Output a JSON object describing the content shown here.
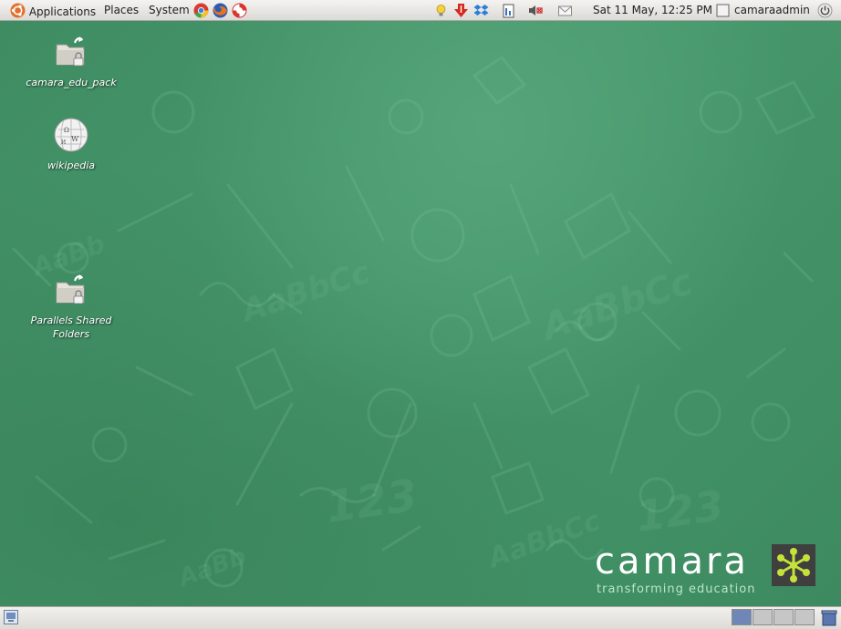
{
  "top_panel": {
    "menus": [
      {
        "label": "Applications",
        "icon": "ubuntu-logo-icon"
      },
      {
        "label": "Places"
      },
      {
        "label": "System"
      }
    ],
    "launchers": [
      "chrome-icon",
      "firefox-icon",
      "help-lifebuoy-icon"
    ],
    "tray": [
      "lightbulb-icon",
      "download-arrow-icon",
      "dropbox-icon",
      "clipboard-icon",
      "volume-muted-icon",
      "mail-icon"
    ],
    "clock": "Sat 11 May, 12:25 PM",
    "user": "camaraadmin",
    "power_icon": "power-icon"
  },
  "desktop": {
    "icons": [
      {
        "label": "camara_edu_pack",
        "icon": "shared-folder-icon"
      },
      {
        "label": "wikipedia",
        "icon": "wikipedia-globe-icon"
      },
      {
        "label": "Parallels Shared Folders",
        "icon": "shared-folder-icon"
      }
    ],
    "brand": {
      "name": "camara",
      "tagline": "transforming education",
      "logo_color": "#c5e23a"
    },
    "colors": {
      "background": "#3f8d63",
      "accent": "#c5e23a"
    }
  },
  "bottom_panel": {
    "show_desktop_icon": "show-desktop-icon",
    "workspaces": 4,
    "active_workspace": 1,
    "trash_icon": "trash-icon"
  }
}
